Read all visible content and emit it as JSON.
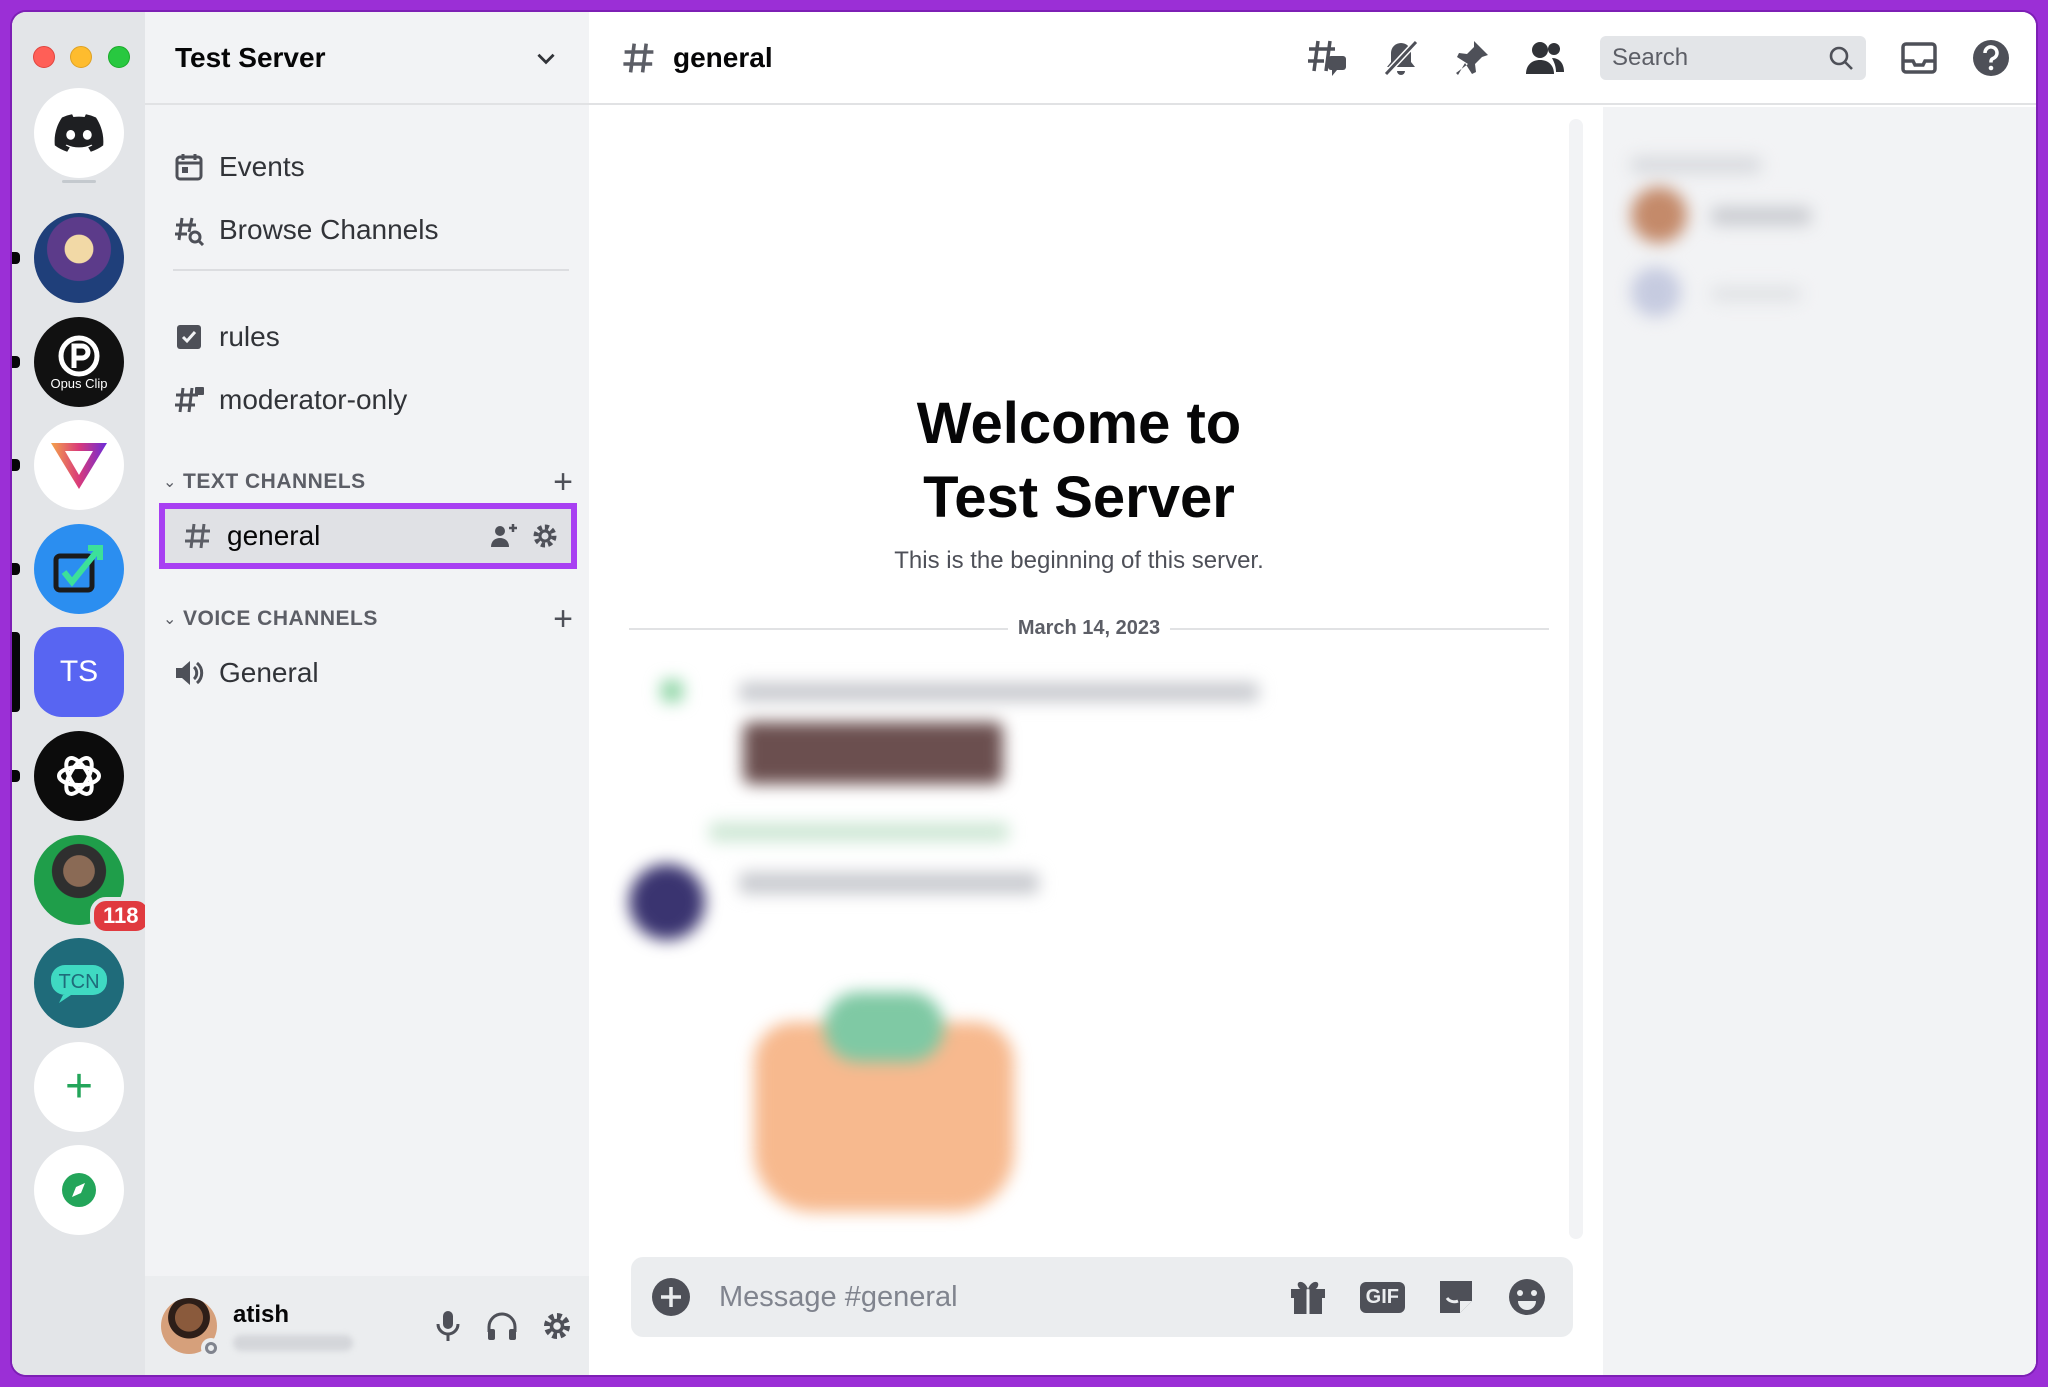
{
  "window": {
    "controls": [
      "close",
      "minimize",
      "maximize"
    ]
  },
  "servers": {
    "home_icon": "discord-logo-icon",
    "items": [
      {
        "name": "wizard-server",
        "unread": true
      },
      {
        "name": "Opus Clip",
        "unread": true
      },
      {
        "name": "triangle-server",
        "unread": true
      },
      {
        "name": "chart-server",
        "unread": true
      },
      {
        "name": "TS",
        "selected": true
      },
      {
        "name": "openai-server",
        "unread": true
      },
      {
        "name": "profile-server",
        "badge": "118"
      },
      {
        "name": "TCN"
      }
    ],
    "add_label": "+",
    "discover_icon": "compass-icon"
  },
  "sidebar": {
    "server_name": "Test Server",
    "events_label": "Events",
    "browse_label": "Browse Channels",
    "rules_label": "rules",
    "moderator_label": "moderator-only",
    "text_category": "TEXT CHANNELS",
    "voice_category": "VOICE CHANNELS",
    "active_channel": "general",
    "voice_channel": "General"
  },
  "user": {
    "name": "atish"
  },
  "header": {
    "channel": "general",
    "search_placeholder": "Search"
  },
  "welcome": {
    "line1": "Welcome to",
    "line2": "Test Server",
    "subtitle": "This is the beginning of this server."
  },
  "date_divider": "March 14, 2023",
  "composer": {
    "placeholder": "Message #general",
    "gif_label": "GIF"
  },
  "colors": {
    "accent": "#a83ff2",
    "brand": "#5865f2",
    "badge": "#e03a3f"
  }
}
